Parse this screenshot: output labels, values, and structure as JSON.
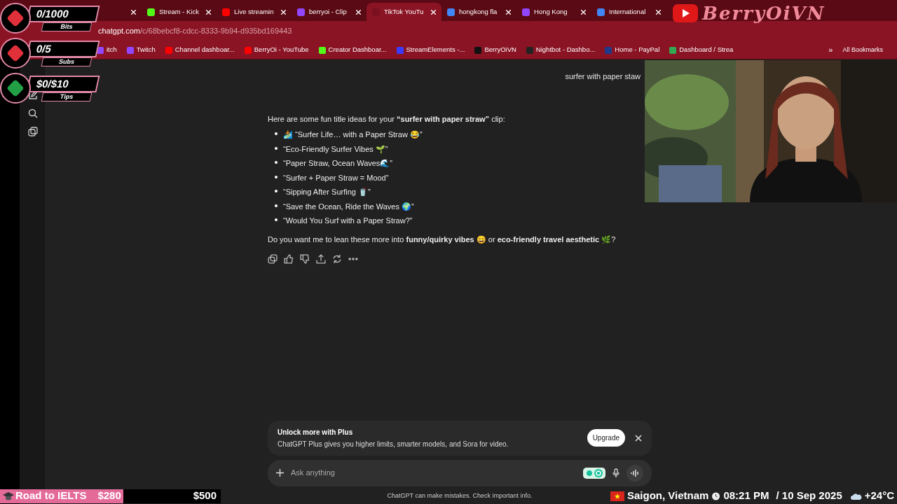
{
  "tabs": [
    {
      "selected": false
    },
    {
      "label": "Stream - Kick",
      "selected": false,
      "color": "#53fc18"
    },
    {
      "label": "Live streamin",
      "selected": false,
      "color": "#ff0000"
    },
    {
      "label": "berryoi - Clip",
      "selected": false,
      "color": "#9146ff"
    },
    {
      "label": "TikTok YouTu",
      "selected": true,
      "color": "#7a1020"
    },
    {
      "label": "hongkong fla",
      "selected": false,
      "color": "#4285f4"
    },
    {
      "label": "Hong Kong",
      "selected": false,
      "color": "#9146ff"
    },
    {
      "label": "International",
      "selected": false,
      "color": "#4285f4"
    }
  ],
  "address": {
    "host": "chatgpt.com",
    "path": "/c/68bebcf8-cdcc-8333-9b94-d935bd169443"
  },
  "bookmarks": [
    {
      "label": "itch",
      "color": "#9146ff"
    },
    {
      "label": "Twitch",
      "color": "#9146ff"
    },
    {
      "label": "Channel dashboar...",
      "color": "#ff0000"
    },
    {
      "label": "BerryOi - YouTube",
      "color": "#ff0000"
    },
    {
      "label": "Creator Dashboar...",
      "color": "#53fc18"
    },
    {
      "label": "StreamElements -...",
      "color": "#3b3bff"
    },
    {
      "label": "BerryOiVN",
      "color": "#111111"
    },
    {
      "label": "Nightbot - Dashbo...",
      "color": "#222222"
    },
    {
      "label": "Home - PayPal",
      "color": "#1e3a8a"
    },
    {
      "label": "Dashboard / Strea",
      "color": "#34a853"
    }
  ],
  "bookmarks_more": "»",
  "all_bookmarks": "All Bookmarks",
  "logo_text": "BerryOiVN",
  "goals": [
    {
      "value": "0/1000",
      "label": "Bits",
      "color": "#e0303a"
    },
    {
      "value": "0/5",
      "label": "Subs",
      "color": "#e0303a"
    },
    {
      "value": "$0/$10",
      "label": "Tips",
      "color": "#22a046"
    }
  ],
  "user_message": "surfer with paper staw",
  "reply": {
    "intro": "Here are some fun title ideas for your **“surfer with paper straw”** clip:",
    "items": [
      "🏄 “Surfer Life… with a Paper Straw 😂”",
      "“Eco-Friendly Surfer Vibes 🌱”",
      "“Paper Straw, Ocean Waves🌊”",
      "“Surfer + Paper Straw = Mood”",
      "“Sipping After Surfing 🥤”",
      "“Save the Ocean, Ride the Waves 🌍”",
      "“Would You Surf with a Paper Straw?”"
    ],
    "outro": "Do you want me to lean these more into **funny/quirky vibes** 😄 or **eco-friendly travel aesthetic** 🌿?"
  },
  "upsell": {
    "title": "Unlock more with Plus",
    "text": "ChatGPT Plus gives you higher limits, smarter models, and Sora for video.",
    "button": "Upgrade"
  },
  "composer": {
    "placeholder": "Ask anything"
  },
  "disclaimer": "ChatGPT can make mistakes. Check important info.",
  "ticker": {
    "label": "Road to IELTS",
    "current": "$280",
    "target": "$500",
    "level": 0.56
  },
  "location": {
    "place": "Saigon, Vietnam",
    "time": "08:21 PM",
    "date": "/ 10 Sep 2025",
    "weather": "+24°C"
  }
}
